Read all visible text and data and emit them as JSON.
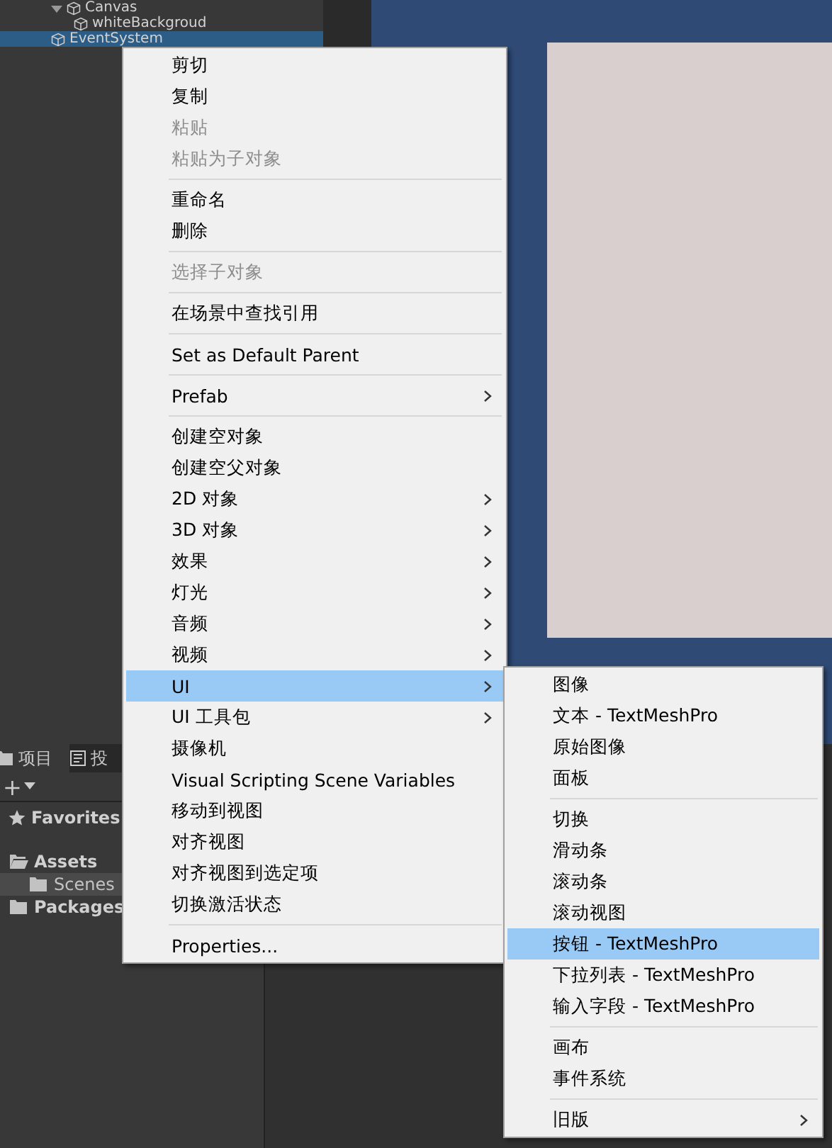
{
  "hierarchy": {
    "items": [
      {
        "label": "Canvas",
        "expanded": true,
        "selected": false,
        "children": [
          {
            "label": "whiteBackgroud",
            "selected": false
          }
        ]
      },
      {
        "label": "EventSystem",
        "selected": true
      }
    ]
  },
  "project": {
    "tabs": [
      {
        "label": "项目",
        "selected": true
      },
      {
        "label": "投",
        "selected": false
      }
    ],
    "add_button": "+",
    "tree": [
      {
        "label": "Favorites",
        "kind": "favorites",
        "selected": false
      },
      {
        "label": "Assets",
        "kind": "folder",
        "expanded": true,
        "selected": false,
        "children": [
          {
            "label": "Scenes",
            "kind": "folder",
            "selected": true
          }
        ]
      },
      {
        "label": "Packages",
        "kind": "folder",
        "selected": false
      }
    ]
  },
  "context_menu": {
    "items": [
      {
        "kind": "item",
        "label": "剪切",
        "disabled": false,
        "submenu": false,
        "selected": false
      },
      {
        "kind": "item",
        "label": "复制",
        "disabled": false,
        "submenu": false,
        "selected": false
      },
      {
        "kind": "item",
        "label": "粘贴",
        "disabled": true,
        "submenu": false,
        "selected": false
      },
      {
        "kind": "item",
        "label": "粘贴为子对象",
        "disabled": true,
        "submenu": false,
        "selected": false
      },
      {
        "kind": "separator"
      },
      {
        "kind": "item",
        "label": "重命名",
        "disabled": false,
        "submenu": false,
        "selected": false
      },
      {
        "kind": "item",
        "label": "删除",
        "disabled": false,
        "submenu": false,
        "selected": false
      },
      {
        "kind": "separator"
      },
      {
        "kind": "item",
        "label": "选择子对象",
        "disabled": true,
        "submenu": false,
        "selected": false
      },
      {
        "kind": "separator"
      },
      {
        "kind": "item",
        "label": "在场景中查找引用",
        "disabled": false,
        "submenu": false,
        "selected": false
      },
      {
        "kind": "separator"
      },
      {
        "kind": "item",
        "label": "Set as Default Parent",
        "disabled": false,
        "submenu": false,
        "selected": false
      },
      {
        "kind": "separator"
      },
      {
        "kind": "item",
        "label": "Prefab",
        "disabled": false,
        "submenu": true,
        "selected": false
      },
      {
        "kind": "separator"
      },
      {
        "kind": "item",
        "label": "创建空对象",
        "disabled": false,
        "submenu": false,
        "selected": false
      },
      {
        "kind": "item",
        "label": "创建空父对象",
        "disabled": false,
        "submenu": false,
        "selected": false
      },
      {
        "kind": "item",
        "label": "2D 对象",
        "disabled": false,
        "submenu": true,
        "selected": false
      },
      {
        "kind": "item",
        "label": "3D 对象",
        "disabled": false,
        "submenu": true,
        "selected": false
      },
      {
        "kind": "item",
        "label": "效果",
        "disabled": false,
        "submenu": true,
        "selected": false
      },
      {
        "kind": "item",
        "label": "灯光",
        "disabled": false,
        "submenu": true,
        "selected": false
      },
      {
        "kind": "item",
        "label": "音频",
        "disabled": false,
        "submenu": true,
        "selected": false
      },
      {
        "kind": "item",
        "label": "视频",
        "disabled": false,
        "submenu": true,
        "selected": false
      },
      {
        "kind": "item",
        "label": "UI",
        "disabled": false,
        "submenu": true,
        "selected": true
      },
      {
        "kind": "item",
        "label": "UI 工具包",
        "disabled": false,
        "submenu": true,
        "selected": false
      },
      {
        "kind": "item",
        "label": "摄像机",
        "disabled": false,
        "submenu": false,
        "selected": false
      },
      {
        "kind": "item",
        "label": "Visual Scripting Scene Variables",
        "disabled": false,
        "submenu": false,
        "selected": false
      },
      {
        "kind": "item",
        "label": "移动到视图",
        "disabled": false,
        "submenu": false,
        "selected": false
      },
      {
        "kind": "item",
        "label": "对齐视图",
        "disabled": false,
        "submenu": false,
        "selected": false
      },
      {
        "kind": "item",
        "label": "对齐视图到选定项",
        "disabled": false,
        "submenu": false,
        "selected": false
      },
      {
        "kind": "item",
        "label": "切换激活状态",
        "disabled": false,
        "submenu": false,
        "selected": false
      },
      {
        "kind": "separator"
      },
      {
        "kind": "item",
        "label": "Properties...",
        "disabled": false,
        "submenu": false,
        "selected": false
      }
    ]
  },
  "submenu": {
    "items": [
      {
        "kind": "item",
        "label": "图像",
        "disabled": false,
        "submenu": false,
        "selected": false
      },
      {
        "kind": "item",
        "label": "文本 - TextMeshPro",
        "disabled": false,
        "submenu": false,
        "selected": false
      },
      {
        "kind": "item",
        "label": "原始图像",
        "disabled": false,
        "submenu": false,
        "selected": false
      },
      {
        "kind": "item",
        "label": "面板",
        "disabled": false,
        "submenu": false,
        "selected": false
      },
      {
        "kind": "separator"
      },
      {
        "kind": "item",
        "label": "切换",
        "disabled": false,
        "submenu": false,
        "selected": false
      },
      {
        "kind": "item",
        "label": "滑动条",
        "disabled": false,
        "submenu": false,
        "selected": false
      },
      {
        "kind": "item",
        "label": "滚动条",
        "disabled": false,
        "submenu": false,
        "selected": false
      },
      {
        "kind": "item",
        "label": "滚动视图",
        "disabled": false,
        "submenu": false,
        "selected": false
      },
      {
        "kind": "item",
        "label": "按钮 - TextMeshPro",
        "disabled": false,
        "submenu": false,
        "selected": true
      },
      {
        "kind": "item",
        "label": "下拉列表 - TextMeshPro",
        "disabled": false,
        "submenu": false,
        "selected": false
      },
      {
        "kind": "item",
        "label": "输入字段 - TextMeshPro",
        "disabled": false,
        "submenu": false,
        "selected": false
      },
      {
        "kind": "separator"
      },
      {
        "kind": "item",
        "label": "画布",
        "disabled": false,
        "submenu": false,
        "selected": false
      },
      {
        "kind": "item",
        "label": "事件系统",
        "disabled": false,
        "submenu": false,
        "selected": false
      },
      {
        "kind": "separator"
      },
      {
        "kind": "item",
        "label": "旧版",
        "disabled": false,
        "submenu": true,
        "selected": false
      }
    ]
  }
}
